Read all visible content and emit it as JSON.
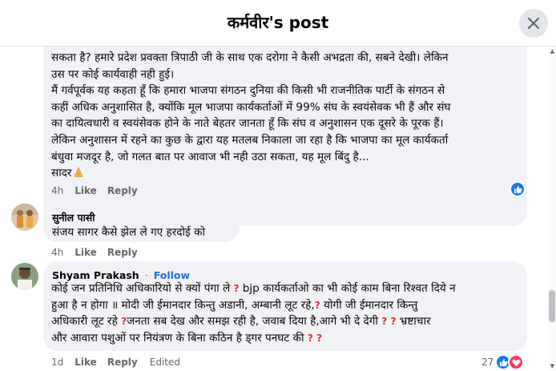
{
  "header": {
    "title": "कर्मवीर's post"
  },
  "comment1": {
    "lines": [
      "सकता है? हमारे प्रदेश प्रवक्ता त्रिपाठी जी के साथ एक दरोगा ने कैसी अभद्रता की, सबने देखी। लेकिन",
      "उस पर कोई कार्यवाही नही हुई।",
      "मैं गर्वपूर्वक यह कहता हूँ कि हमारा भाजपा संगठन दुनिया की किसी भी राजनीतिक पार्टी के संगठन से",
      "कहीं अधिक अनुशासित है, क्योंकि मूल भाजपा कार्यकर्ताओं में 99% संघ के स्वयंसेवक भी हैं और संघ",
      "का दायित्वधारी व स्वयंसेवक होने के नाते बेहतर जानता हूँ कि संघ व अनुशासन एक दूसरे के पूरक हैं।",
      "लेकिन अनुशासन में रहने का कुछ के द्वारा यह मतलब निकाला जा रहा है कि भाजपा का मूल कार्यकर्ता",
      "बंधुवा मजदूर है, जो गलत बात पर आवाज भी नही उठा सकता, यह मूल बिंदु है..."
    ],
    "closing": "सादर",
    "time": "4h",
    "like": "Like",
    "reply": "Reply"
  },
  "comment2": {
    "author": "सुनील पासी",
    "text": "संजय सागर कैसे झेल ले गए हरदोई को",
    "time": "4h",
    "like": "Like",
    "reply": "Reply"
  },
  "comment3": {
    "author": "Shyam Prakash",
    "follow": "Follow",
    "dot": "·",
    "line1a": "कोई जन प्रतिनिधि अधिकारियो से क्यों पंगा ले ",
    "line1b": " bjp कार्यकर्ताओ का भी कोई काम बिना रिश्वत दिये न",
    "line2a": "हुआ है न होगा ॥ मोदी जी ईमानदार किन्तु अडानी, अम्बानी लूट रहे,",
    "line2b": " योगी जी ईमानदार किन्तु",
    "line3a": "अधिकारी लूट रहे ",
    "line3b": "जनता सब देख और समझ रही है, जवाब दिया है,आगे भी दे देगी ",
    "line3c": " भ्रष्टाचार",
    "line4a": "और आवारा पशुओं पर नियंत्रण के बिना कठिन है ड्गर पनघट की ",
    "qmark": "?",
    "time": "1d",
    "like": "Like",
    "reply": "Reply",
    "edited": "Edited",
    "reaction_count": "27"
  },
  "colors": {
    "bubble": "#f0f2f5",
    "link": "#216fdb",
    "meta": "#65676b",
    "like_blue": "#1877f2",
    "love_red": "#f33e58",
    "question_red": "#e02c2c"
  },
  "icons": [
    "close-icon",
    "like-reaction-icon",
    "love-reaction-icon",
    "folded-hands-emoji",
    "question-mark-emoji"
  ]
}
